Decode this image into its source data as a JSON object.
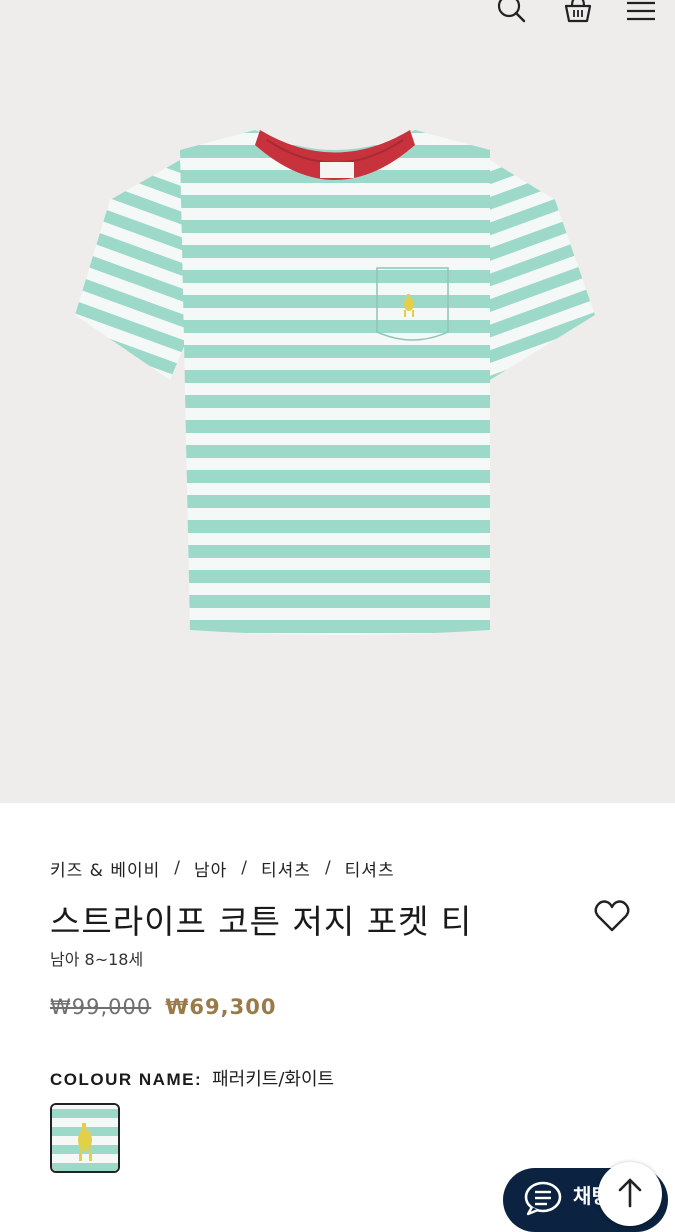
{
  "breadcrumb": [
    "키즈 & 베이비",
    "남아",
    "티셔츠",
    "티셔츠"
  ],
  "breadcrumb_separator": "/",
  "product": {
    "title": "스트라이프 코튼 저지 포켓 티",
    "subtitle": "남아 8~18세",
    "original_price": "₩99,000",
    "sale_price": "₩69,300"
  },
  "colour": {
    "label": "COLOUR NAME:",
    "value": "패러키트/화이트"
  },
  "chat": {
    "label": "채팅"
  },
  "icons": {
    "search": "search-icon",
    "bag": "shopping-bag-icon",
    "menu": "hamburger-menu-icon",
    "wishlist": "heart-icon",
    "chat": "chat-icon",
    "scroll_top": "arrow-up-icon"
  },
  "colors": {
    "hero_bg": "#efedeb",
    "stripe_mint": "#9dd9c9",
    "stripe_white": "#f4f8f6",
    "collar_red": "#c8323d",
    "logo_yellow": "#e3d04a",
    "sale_price": "#9a7a48",
    "chat_bg": "#0b2340"
  }
}
